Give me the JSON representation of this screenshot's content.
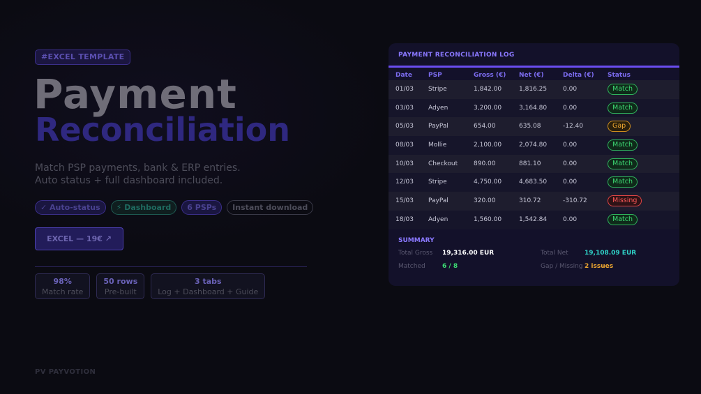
{
  "left": {
    "tag": "#EXCEL TEMPLATE",
    "title_line1": "Payment",
    "title_line2": "Reconciliation",
    "subtitle_line1": "Match PSP payments, bank & ERP entries.",
    "subtitle_line2": "Auto status + full dashboard included.",
    "pills": [
      "✓ Auto-status",
      "⚡ Dashboard",
      "6 PSPs",
      "Instant download"
    ],
    "cta_label": "EXCEL — 19€ ↗",
    "stats": [
      {
        "value": "98%",
        "label": "Match rate"
      },
      {
        "value": "50 rows",
        "label": "Pre-built"
      },
      {
        "value": "3 tabs",
        "label": "Log + Dashboard + Guide"
      }
    ],
    "brand": "PV PAYVOTION"
  },
  "panel": {
    "title": "PAYMENT RECONCILIATION LOG",
    "columns": [
      "Date",
      "PSP",
      "Gross (€)",
      "Net (€)",
      "Delta (€)",
      "Status"
    ],
    "rows": [
      [
        "01/03",
        "Stripe",
        "1,842.00",
        "1,816.25",
        "0.00",
        "Match"
      ],
      [
        "03/03",
        "Adyen",
        "3,200.00",
        "3,164.80",
        "0.00",
        "Match"
      ],
      [
        "05/03",
        "PayPal",
        "654.00",
        "635.08",
        "-12.40",
        "Gap"
      ],
      [
        "08/03",
        "Mollie",
        "2,100.00",
        "2,074.80",
        "0.00",
        "Match"
      ],
      [
        "10/03",
        "Checkout",
        "890.00",
        "881.10",
        "0.00",
        "Match"
      ],
      [
        "12/03",
        "Stripe",
        "4,750.00",
        "4,683.50",
        "0.00",
        "Match"
      ],
      [
        "15/03",
        "PayPal",
        "320.00",
        "310.72",
        "-310.72",
        "Missing"
      ],
      [
        "18/03",
        "Adyen",
        "1,560.00",
        "1,542.84",
        "0.00",
        "Match"
      ]
    ],
    "summary": {
      "title": "SUMMARY",
      "total_gross_label": "Total Gross",
      "total_gross": "19,316.00 EUR",
      "total_net_label": "Total Net",
      "total_net": "19,108.09 EUR",
      "matched_label": "Matched",
      "matched": "6 / 8",
      "gap_label": "Gap / Missing",
      "gap": "2 issues"
    }
  },
  "colors": {
    "accent": "#6a4df0",
    "match": "#3ddc74",
    "gap": "#f0a830",
    "missing": "#ff5a5a"
  }
}
